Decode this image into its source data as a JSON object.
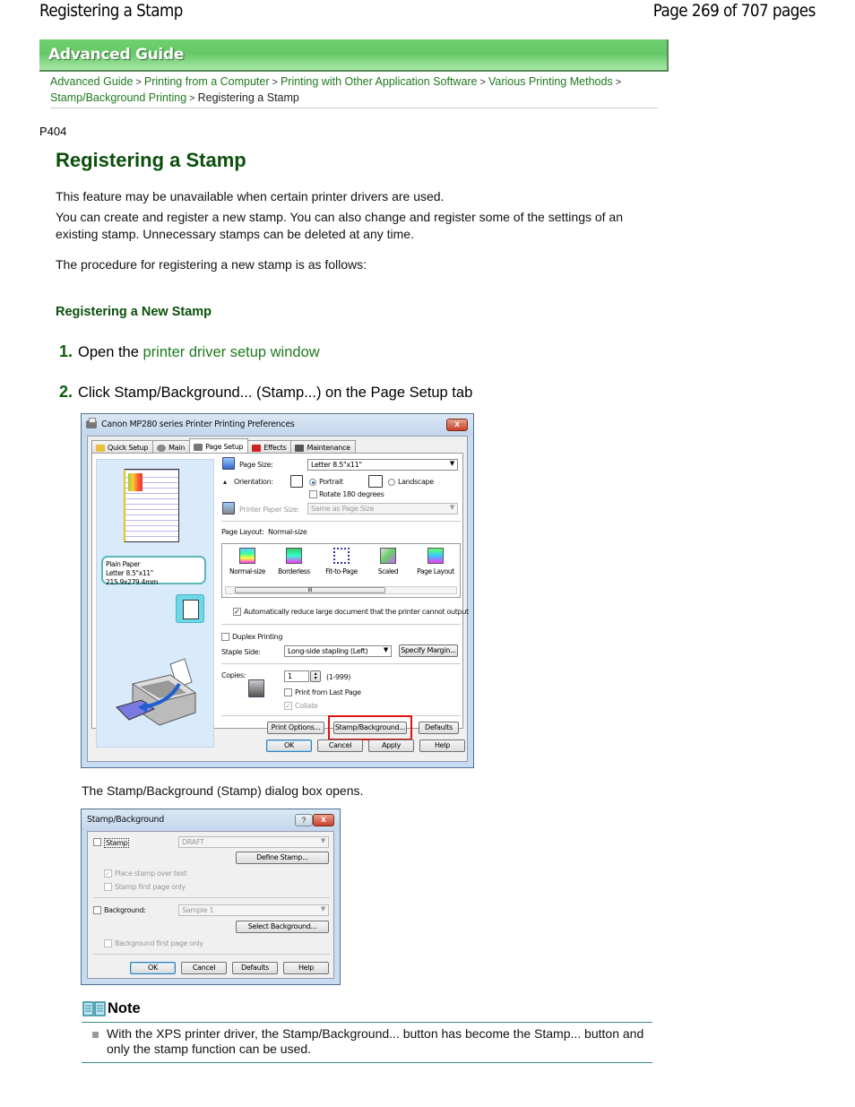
{
  "header": {
    "doc_title": "Registering a Stamp",
    "page_indicator": "Page 269 of 707 pages"
  },
  "banner": {
    "label": "Advanced Guide"
  },
  "breadcrumb": {
    "items": [
      {
        "label": "Advanced Guide",
        "link": true
      },
      {
        "label": "Printing from a Computer",
        "link": true
      },
      {
        "label": "Printing with Other Application Software",
        "link": true
      },
      {
        "label": "Various Printing Methods",
        "link": true
      },
      {
        "label": "Stamp/Background Printing",
        "link": true
      },
      {
        "label": "Registering a Stamp",
        "link": false
      }
    ],
    "separator": ">"
  },
  "page_code": "P404",
  "title": "Registering a Stamp",
  "intro": {
    "p1": "This feature may be unavailable when certain printer drivers are used.",
    "p2": "You can create and register a new stamp. You can also change and register some of the settings of an existing stamp. Unnecessary stamps can be deleted at any time.",
    "p3": "The procedure for registering a new stamp is as follows:"
  },
  "section_heading": "Registering a New Stamp",
  "steps": [
    {
      "num": "1.",
      "prefix": "Open the ",
      "link": "printer driver setup window"
    },
    {
      "num": "2.",
      "text": "Click Stamp/Background... (Stamp...) on the Page Setup tab"
    }
  ],
  "prefs_dialog": {
    "title": "Canon MP280 series Printer Printing Preferences",
    "close": "x",
    "tabs": [
      {
        "label": "Quick Setup",
        "active": false
      },
      {
        "label": "Main",
        "active": false
      },
      {
        "label": "Page Setup",
        "active": true
      },
      {
        "label": "Effects",
        "active": false
      },
      {
        "label": "Maintenance",
        "active": false
      }
    ],
    "media_info": {
      "line1": "Plain Paper",
      "line2": "Letter 8.5\"x11\" 215.9x279.4mm"
    },
    "page_size_label": "Page Size:",
    "page_size_value": "Letter 8.5\"x11\"",
    "orientation_label": "Orientation:",
    "portrait_label": "Portrait",
    "portrait_selected": true,
    "landscape_label": "Landscape",
    "rotate_label": "Rotate 180 degrees",
    "rotate_checked": false,
    "printer_paper_size_label": "Printer Paper Size:",
    "printer_paper_size_value": "Same as Page Size",
    "page_layout_label": "Page Layout:",
    "page_layout_value": "Normal-size",
    "layouts": [
      "Normal-size",
      "Borderless",
      "Fit-to-Page",
      "Scaled",
      "Page Layout"
    ],
    "scroll_thumb": "III",
    "auto_reduce_label": "Automatically reduce large document that the printer cannot output",
    "auto_reduce_checked": true,
    "duplex_label": "Duplex Printing",
    "duplex_checked": false,
    "staple_side_label": "Staple Side:",
    "staple_side_value": "Long-side stapling (Left)",
    "specify_margin_btn": "Specify Margin...",
    "copies_label": "Copies:",
    "copies_value": "1",
    "copies_range": "(1-999)",
    "print_last_label": "Print from Last Page",
    "print_last_checked": false,
    "collate_label": "Collate",
    "collate_checked": true,
    "print_options_btn": "Print Options...",
    "stamp_bg_btn": "Stamp/Background...",
    "defaults_btn": "Defaults",
    "ok_btn": "OK",
    "cancel_btn": "Cancel",
    "apply_btn": "Apply",
    "help_btn": "Help"
  },
  "after_step2": "The Stamp/Background (Stamp) dialog box opens.",
  "stamp_dialog": {
    "title": "Stamp/Background",
    "help": "?",
    "close": "x",
    "stamp_label": "Stamp",
    "stamp_checked": false,
    "stamp_value": "DRAFT",
    "define_stamp_btn": "Define Stamp...",
    "place_over_text_label": "Place stamp over text",
    "place_over_text_checked": true,
    "stamp_first_page_label": "Stamp first page only",
    "stamp_first_page_checked": false,
    "background_label": "Background:",
    "background_checked": false,
    "background_value": "Sample 1",
    "select_background_btn": "Select Background...",
    "bg_first_page_label": "Background first page only",
    "bg_first_page_checked": false,
    "ok_btn": "OK",
    "cancel_btn": "Cancel",
    "defaults_btn": "Defaults",
    "help_btn": "Help"
  },
  "note": {
    "heading": "Note",
    "items": [
      "With the XPS printer driver, the Stamp/Background... button has become the Stamp... button and only the stamp function can be used."
    ]
  },
  "colors": {
    "heading_green": "#0a4f0a",
    "link_green": "#1f7a1f",
    "banner_green": "#66c866",
    "highlight_red": "#e01010",
    "note_rule": "#3a8a8a"
  }
}
